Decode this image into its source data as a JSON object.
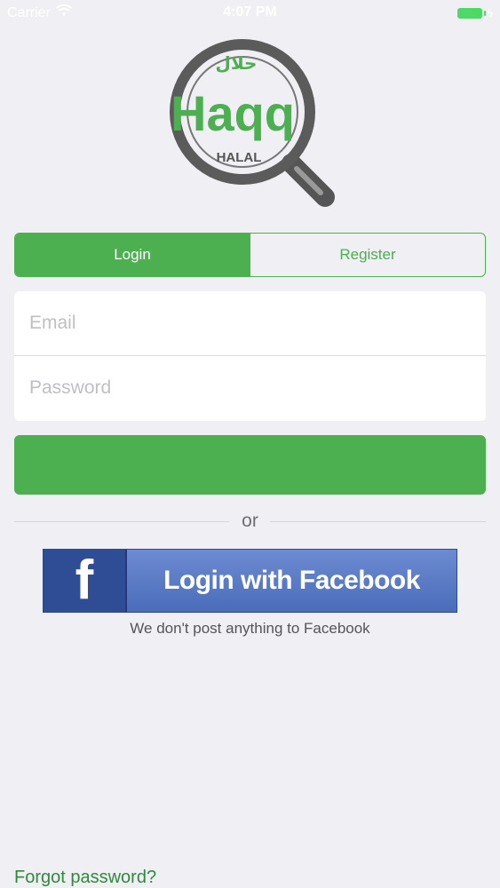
{
  "status_bar": {
    "carrier": "Carrier",
    "time": "4:07 PM"
  },
  "logo": {
    "brand": "Haqq",
    "arabic": "حلال",
    "tagline": "HALAL"
  },
  "tabs": [
    {
      "label": "Login",
      "active": true
    },
    {
      "label": "Register",
      "active": false
    }
  ],
  "form": {
    "email_placeholder": "Email",
    "email_value": "",
    "password_placeholder": "Password",
    "password_value": "",
    "submit_label": ""
  },
  "divider": {
    "or_label": "or"
  },
  "facebook": {
    "button_label": "Login with Facebook",
    "icon_glyph": "f",
    "note": "We don't post anything to Facebook"
  },
  "forgot_password_label": "Forgot password?",
  "colors": {
    "accent": "#4caf50",
    "facebook_blue": "#4a6cb9",
    "background": "#efeff4"
  },
  "icons": [
    "wifi-icon",
    "battery-icon",
    "magnifier-logo",
    "facebook-icon"
  ]
}
